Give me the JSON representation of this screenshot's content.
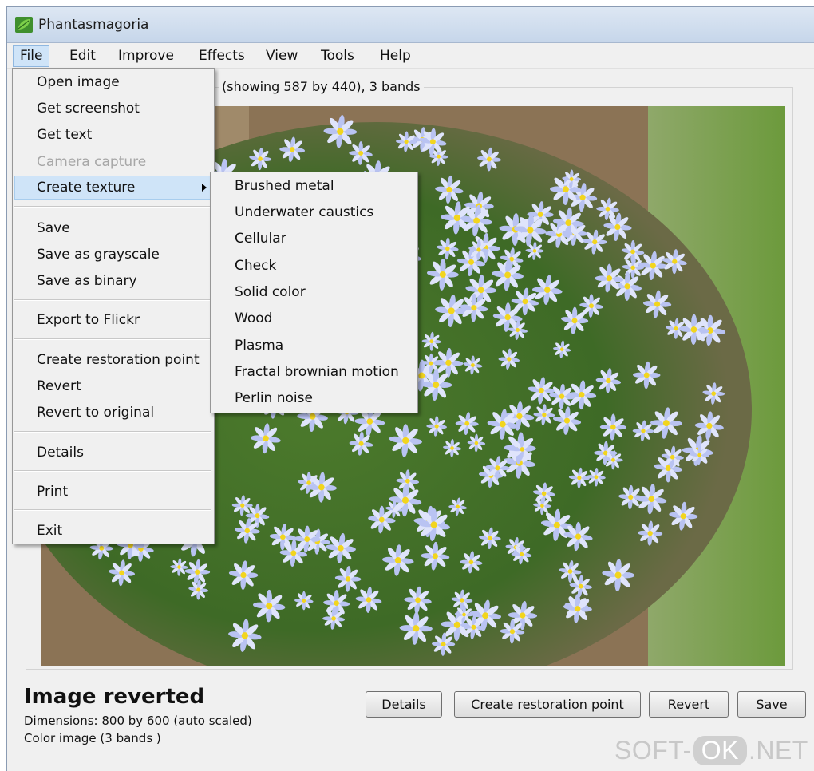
{
  "window": {
    "title": "Phantasmagoria"
  },
  "menubar": {
    "items": [
      "File",
      "Edit",
      "Improve",
      "Effects",
      "View",
      "Tools",
      "Help"
    ]
  },
  "image_panel": {
    "info": "(showing 587 by 440), 3 bands"
  },
  "file_menu": {
    "items": [
      {
        "label": "Open image"
      },
      {
        "label": "Get screenshot"
      },
      {
        "label": "Get text"
      },
      {
        "label": "Camera capture",
        "disabled": true
      },
      {
        "label": "Create texture",
        "highlighted": true,
        "submenu": true
      },
      {
        "label": "Save"
      },
      {
        "label": "Save as grayscale"
      },
      {
        "label": "Save as binary"
      },
      {
        "label": "Export to Flickr"
      },
      {
        "label": "Create restoration point"
      },
      {
        "label": "Revert"
      },
      {
        "label": "Revert to original"
      },
      {
        "label": "Details"
      },
      {
        "label": "Print"
      },
      {
        "label": "Exit"
      }
    ]
  },
  "texture_submenu": {
    "items": [
      "Brushed metal",
      "Underwater caustics",
      "Cellular",
      "Check",
      "Solid color",
      "Wood",
      "Plasma",
      "Fractal brownian motion",
      "Perlin noise"
    ]
  },
  "status": {
    "title": "Image reverted",
    "dimensions": "Dimensions: 800 by 600 (auto scaled)",
    "color": "Color image (3 bands )"
  },
  "buttons": {
    "details": "Details",
    "restore": "Create restoration point",
    "revert": "Revert",
    "save": "Save"
  },
  "watermark": {
    "left": "SOFT-",
    "ok": "OK",
    "right": ".NET"
  }
}
